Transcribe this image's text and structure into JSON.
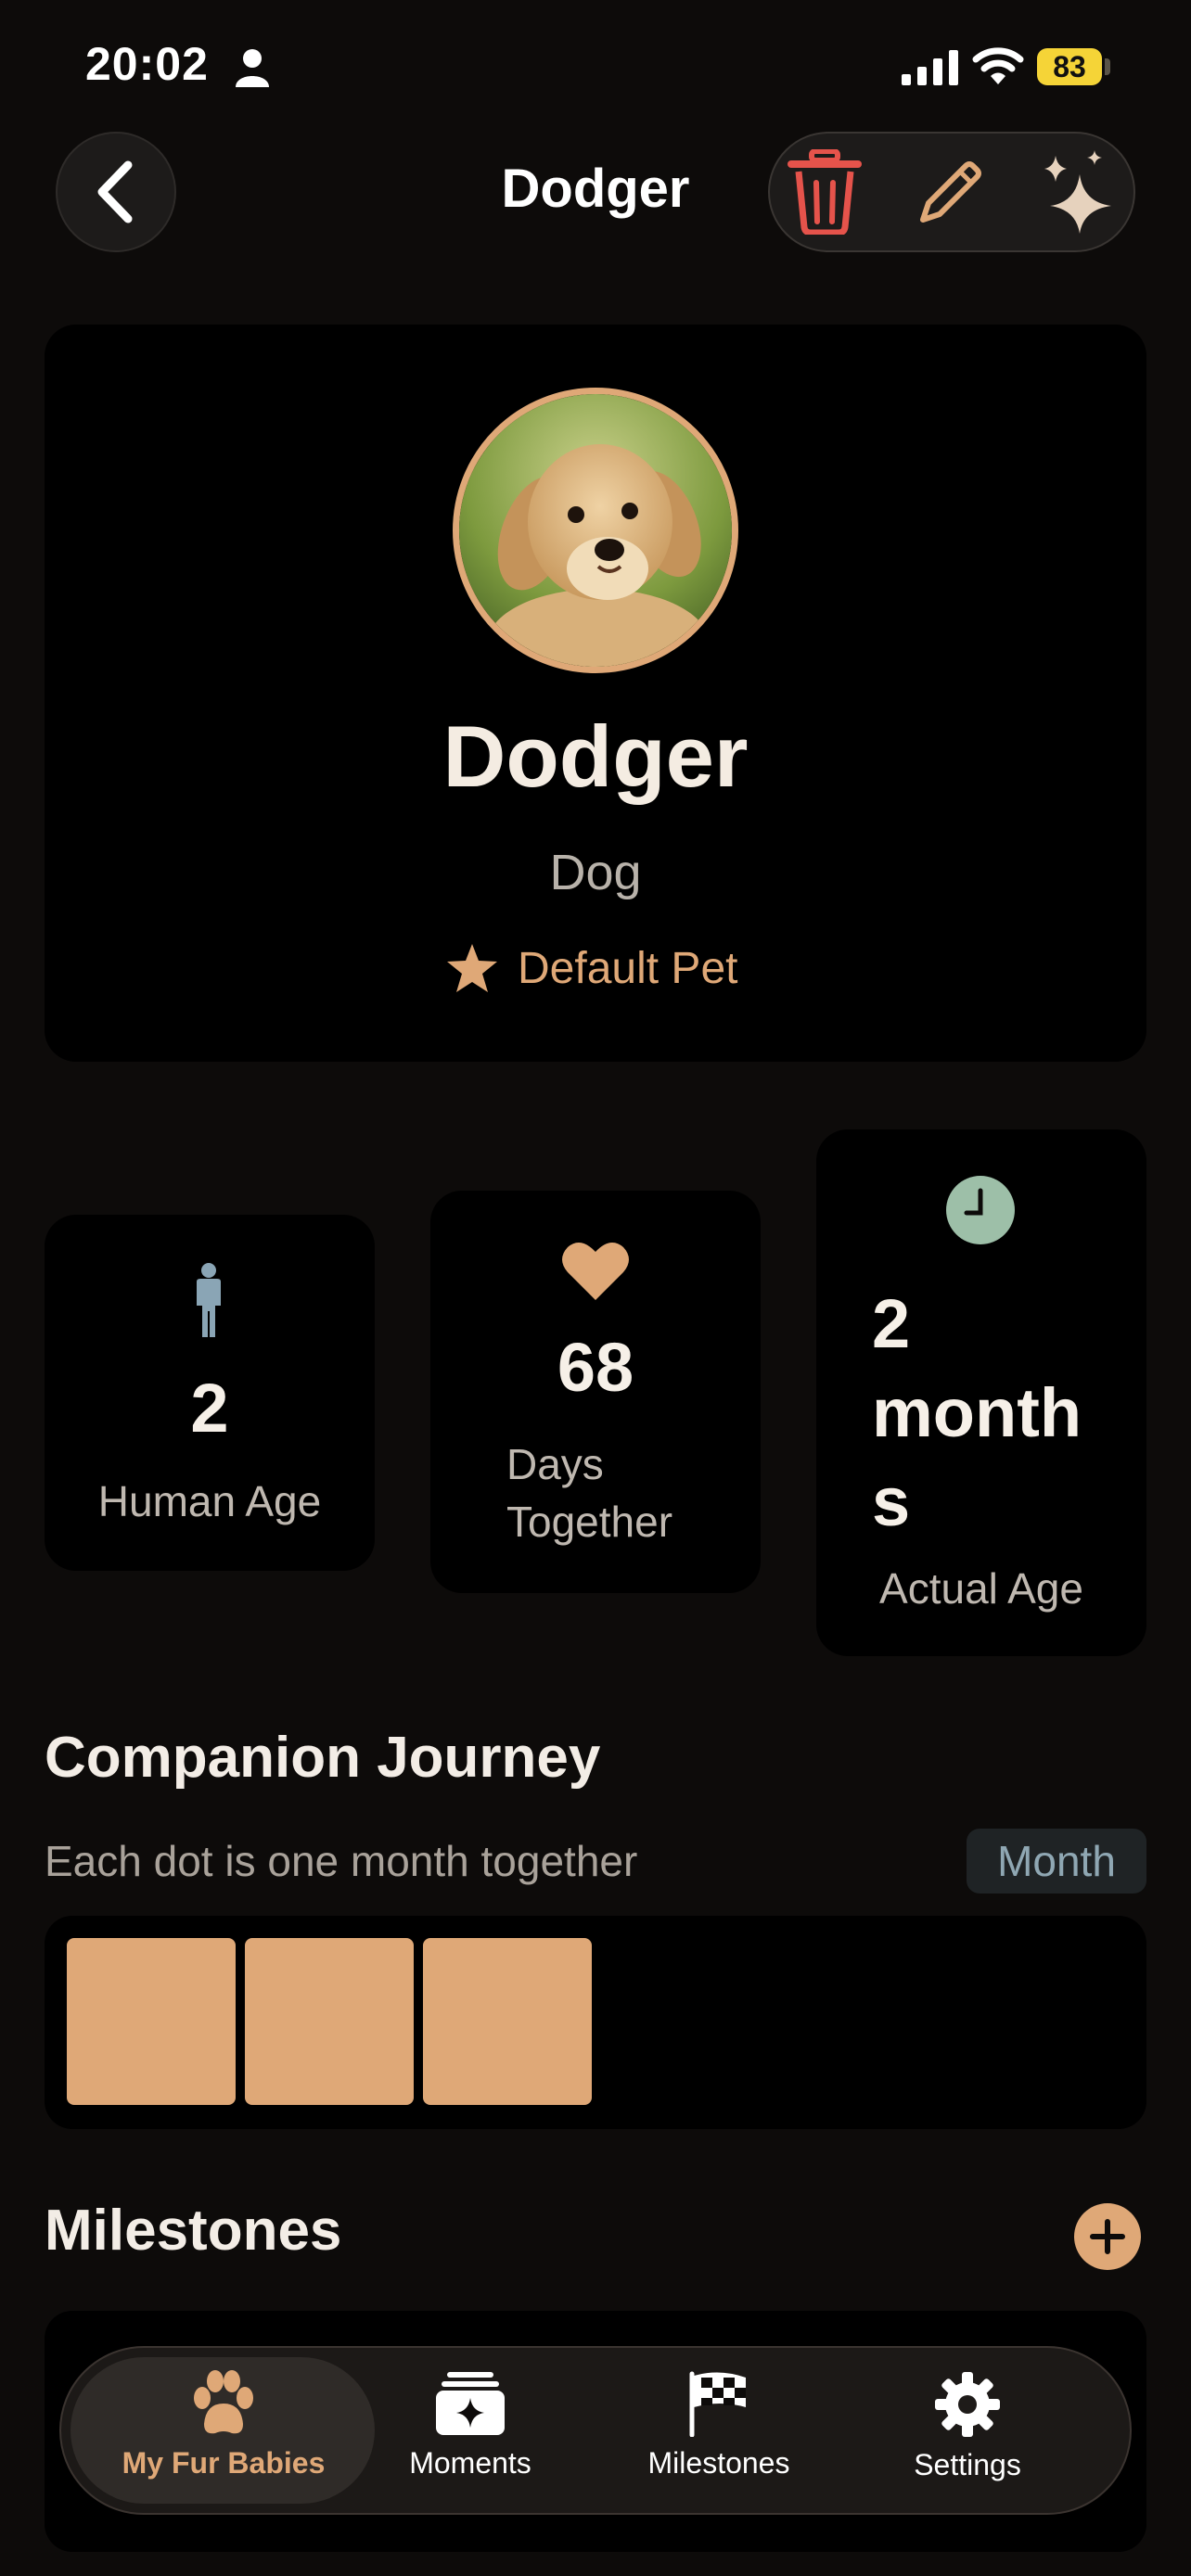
{
  "status_bar": {
    "time": "20:02",
    "battery": "83"
  },
  "nav": {
    "title": "Dodger"
  },
  "profile": {
    "name": "Dodger",
    "species": "Dog",
    "default_label": "Default Pet"
  },
  "stats": {
    "human_age": {
      "value": "2",
      "label": "Human Age"
    },
    "days_together": {
      "value": "68",
      "label_line1": "Days",
      "label_line2": "Together"
    },
    "actual_age": {
      "value_line1": "2",
      "value_line2": "month",
      "value_line3": "s",
      "label": "Actual Age"
    }
  },
  "journey": {
    "title": "Companion Journey",
    "subtitle": "Each dot is one month together",
    "unit_toggle": "Month",
    "months_count": 3
  },
  "milestones": {
    "title": "Milestones"
  },
  "tab_bar": {
    "tabs": [
      {
        "label": "My Fur Babies",
        "icon": "paw-icon",
        "active": true
      },
      {
        "label": "Moments",
        "icon": "moments-stack-icon",
        "active": false
      },
      {
        "label": "Milestones",
        "icon": "checkered-flag-icon",
        "active": false
      },
      {
        "label": "Settings",
        "icon": "gear-icon",
        "active": false
      }
    ]
  },
  "colors": {
    "accent": "#dfa877",
    "delete": "#e5534b",
    "background": "#0d0b0a",
    "card": "#000000",
    "clock_badge": "#9dbfa8",
    "person_icon": "#8aa5b5"
  }
}
